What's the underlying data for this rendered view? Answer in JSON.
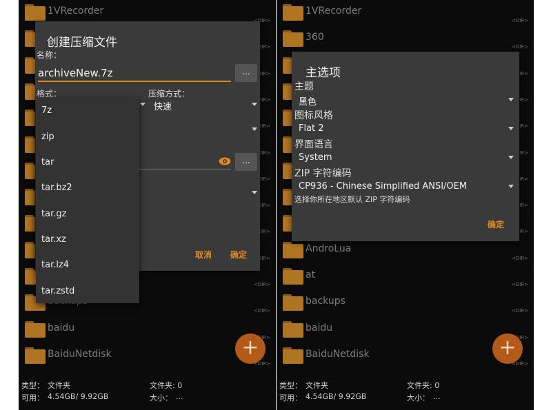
{
  "left_screen": {
    "files": [
      {
        "name": "1VRecorder",
        "dir": "<DIR>"
      },
      {
        "name": "",
        "dir": "<DIR>"
      },
      {
        "name": "",
        "dir": "<DIR>"
      },
      {
        "name": "",
        "dir": "<DIR>"
      },
      {
        "name": "",
        "dir": "<DIR>"
      },
      {
        "name": "",
        "dir": "<DIR>"
      },
      {
        "name": "",
        "dir": "<DIR>"
      },
      {
        "name": "",
        "dir": "<DIR>"
      },
      {
        "name": "",
        "dir": "<DIR>"
      },
      {
        "name": "",
        "dir": "<DIR>"
      },
      {
        "name": "",
        "dir": "<DIR>"
      },
      {
        "name": "backups",
        "dir": "<DIR>"
      },
      {
        "name": "baidu",
        "dir": "<DIR>"
      },
      {
        "name": "BaiduNetdisk",
        "dir": "<DIR>"
      }
    ],
    "dialog": {
      "title": "创建压缩文件",
      "name_label": "名称：",
      "name_value": "archiveNew.7z",
      "browse_button": "...",
      "format_label": "格式：",
      "method_label": "压缩方式：",
      "method_value": "快速",
      "password_button": "...",
      "cancel": "取消",
      "ok": "确定"
    },
    "format_options": [
      "7z",
      "zip",
      "tar",
      "tar.bz2",
      "tar.gz",
      "tar.xz",
      "tar.lz4",
      "tar.zstd"
    ],
    "status": {
      "type_label": "类型：",
      "type_value": "文件夹",
      "folders_label": "文件夹: 0",
      "avail_label": "可用：",
      "avail_value": "4.54GB/ 9.92GB",
      "size_label": "大小：",
      "size_value": "..."
    },
    "fab_icon": "+"
  },
  "right_screen": {
    "files": [
      {
        "name": "1VRecorder",
        "dir": "<DIR>"
      },
      {
        "name": "360",
        "dir": "<DIR>"
      },
      {
        "name": "",
        "dir": "<DIR>"
      },
      {
        "name": "",
        "dir": "<DIR>"
      },
      {
        "name": "",
        "dir": "<DIR>"
      },
      {
        "name": "",
        "dir": "<DIR>"
      },
      {
        "name": "",
        "dir": "<DIR>"
      },
      {
        "name": "",
        "dir": "<DIR>"
      },
      {
        "name": "",
        "dir": "<DIR>"
      },
      {
        "name": "AndroLua",
        "dir": "<DIR>"
      },
      {
        "name": "at",
        "dir": "<DIR>"
      },
      {
        "name": "backups",
        "dir": "<DIR>"
      },
      {
        "name": "baidu",
        "dir": "<DIR>"
      },
      {
        "name": "BaiduNetdisk",
        "dir": "<DIR>"
      }
    ],
    "dialog": {
      "title": "主选项",
      "theme_label": "主题",
      "theme_value": "黑色",
      "icon_style_label": "图标风格",
      "icon_style_value": "Flat 2",
      "language_label": "界面语言",
      "language_value": "System",
      "zip_encoding_label": "ZIP 字符编码",
      "zip_encoding_value": "CP936 - Chinese Simplified ANSI/OEM",
      "zip_encoding_hint": "选择你所在地区默认 ZIP 字符编码",
      "ok": "确定"
    },
    "status": {
      "type_label": "类型：",
      "type_value": "文件夹",
      "folders_label": "文件夹: 0",
      "avail_label": "可用：",
      "avail_value": "4.54GB/ 9.92GB",
      "size_label": "大小：",
      "size_value": "..."
    },
    "fab_icon": "+"
  },
  "colors": {
    "accent": "#e08a1e",
    "folder": "#b07522",
    "fab": "#b45a19",
    "dialog_bg": "#3a3a3a"
  }
}
